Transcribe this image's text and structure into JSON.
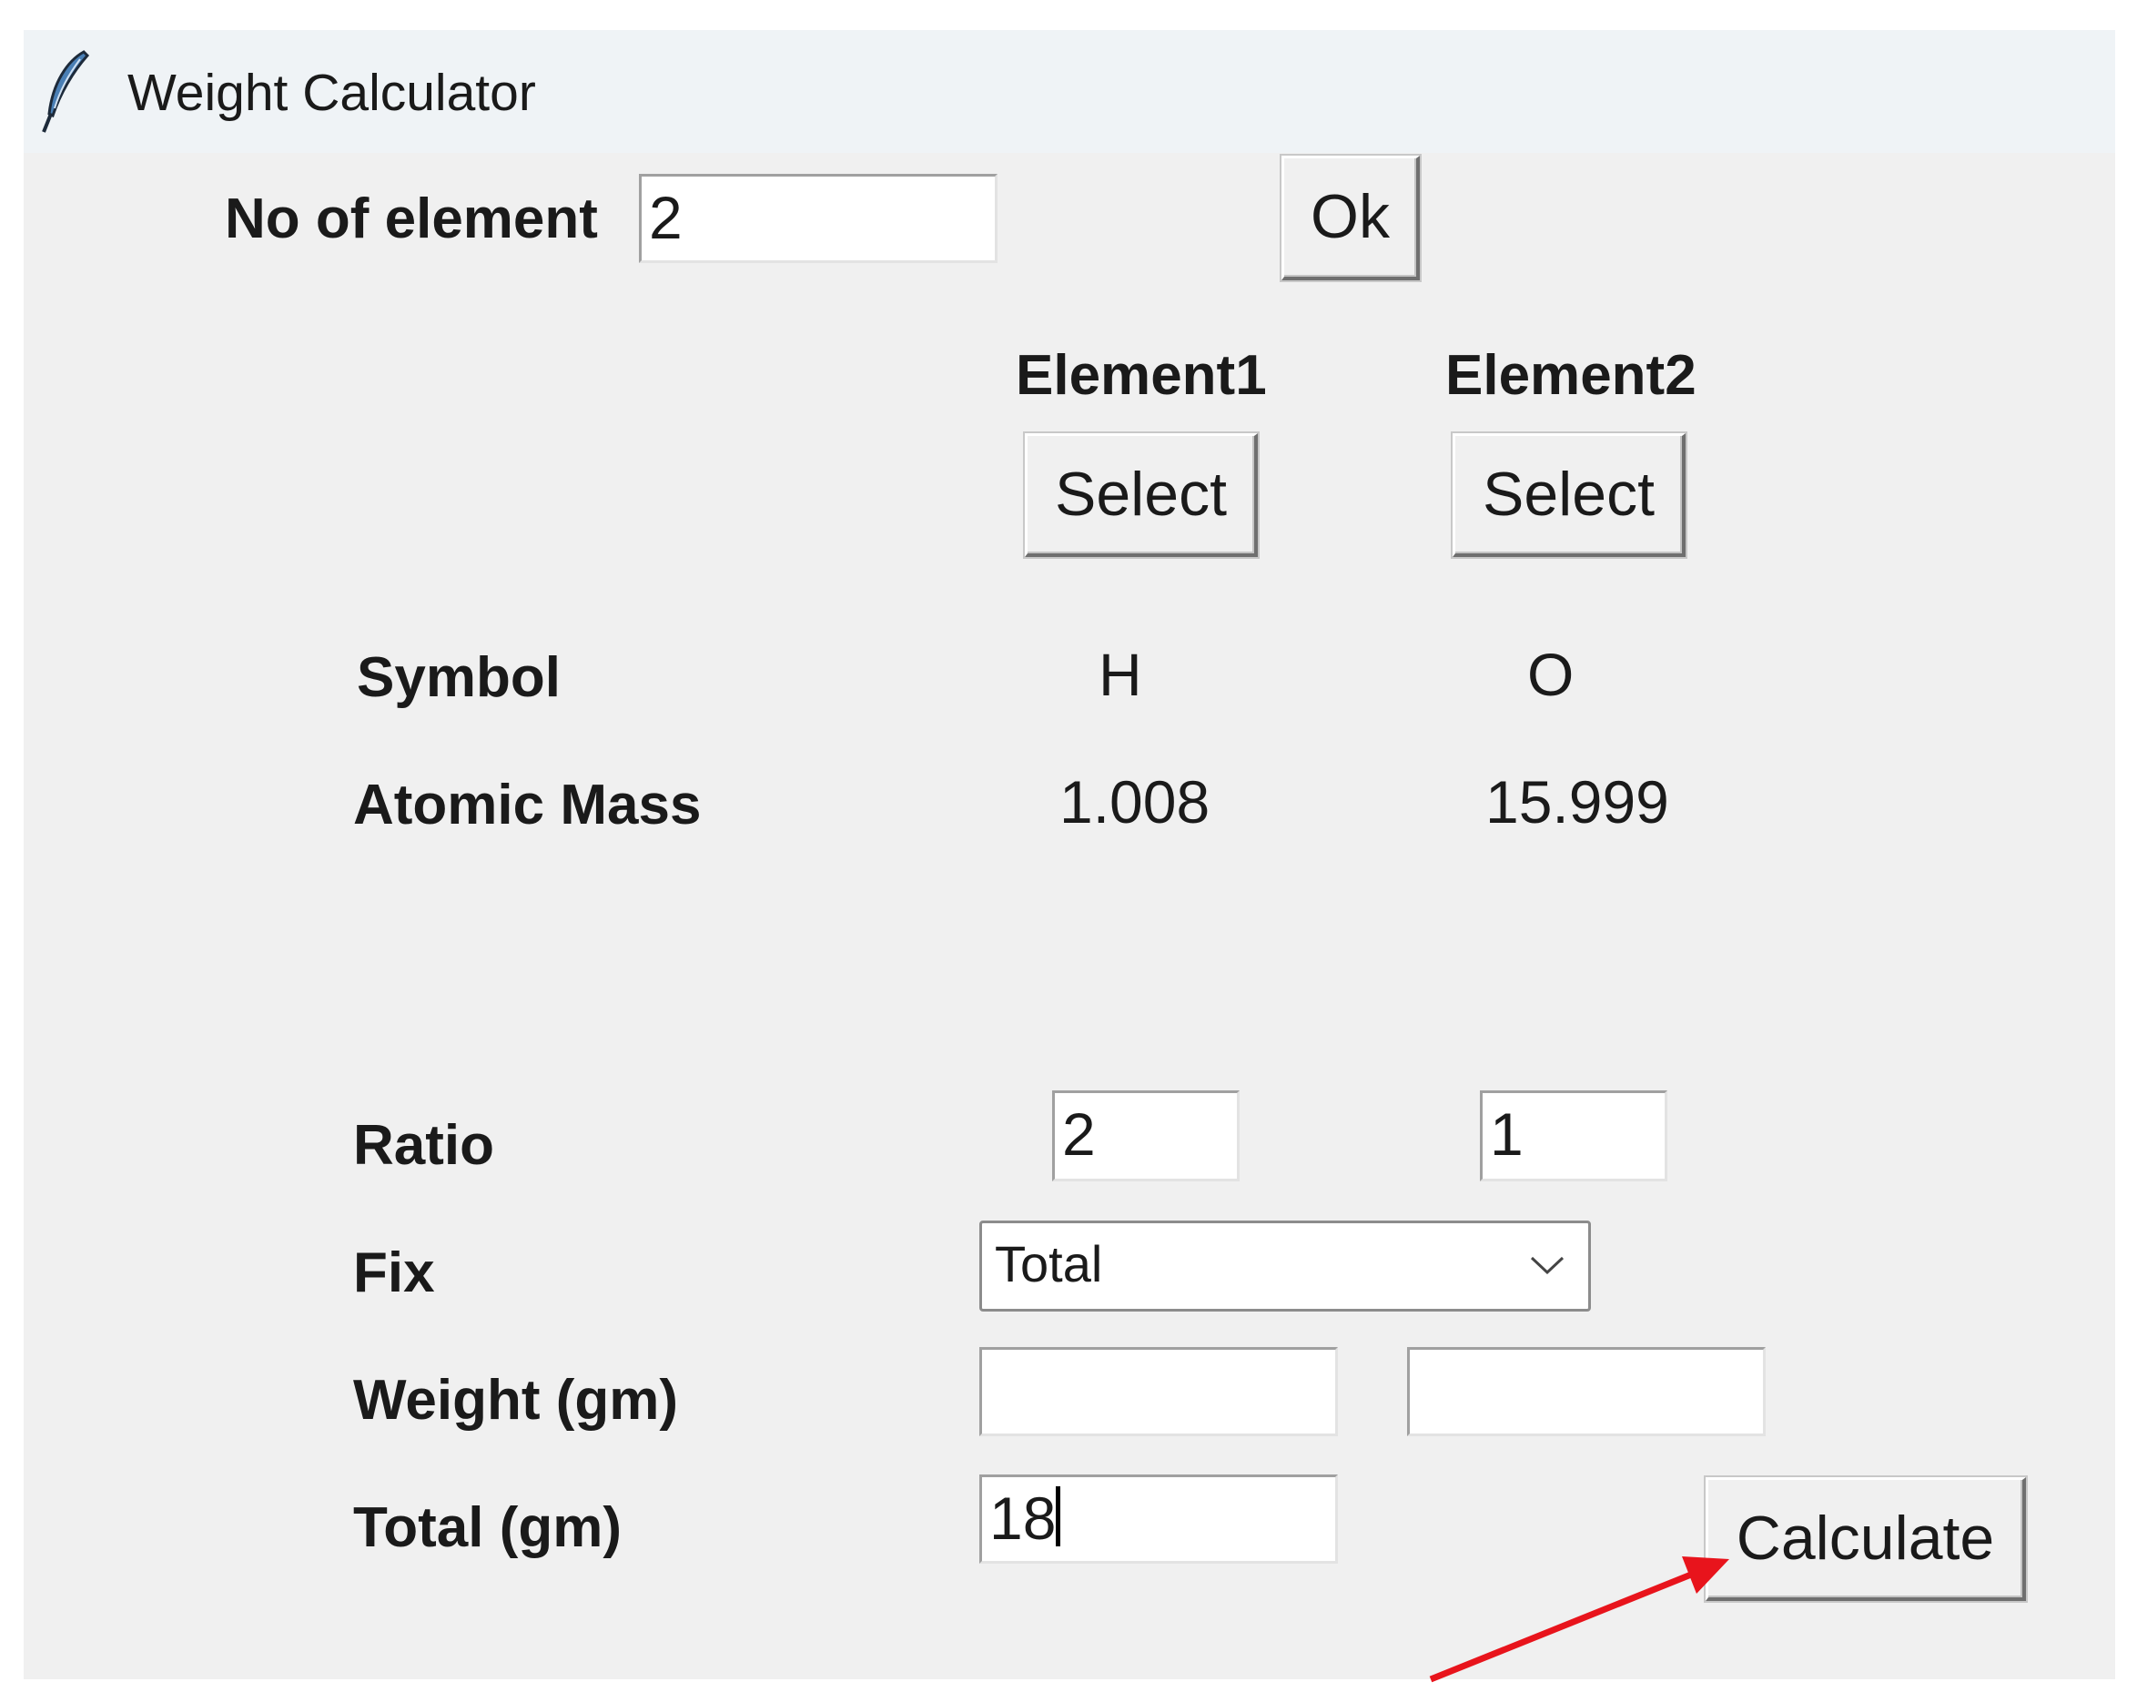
{
  "window": {
    "title": "Weight Calculator",
    "icon": "feather-icon"
  },
  "no_of_element": {
    "label": "No of element",
    "value": "2",
    "ok_label": "Ok"
  },
  "elements": [
    {
      "header": "Element1",
      "select_label": "Select",
      "symbol": "H",
      "atomic_mass": "1.008",
      "ratio": "2",
      "weight": ""
    },
    {
      "header": "Element2",
      "select_label": "Select",
      "symbol": "O",
      "atomic_mass": "15.999",
      "ratio": "1",
      "weight": ""
    }
  ],
  "rows": {
    "symbol_label": "Symbol",
    "atomic_mass_label": "Atomic Mass",
    "ratio_label": "Ratio",
    "fix_label": "Fix",
    "weight_label": "Weight (gm)",
    "total_label": "Total (gm)"
  },
  "fix": {
    "selected": "Total"
  },
  "total": {
    "value": "18"
  },
  "calculate_label": "Calculate",
  "annotation": {
    "color": "#e8141c",
    "points_to": "calculate-button"
  }
}
